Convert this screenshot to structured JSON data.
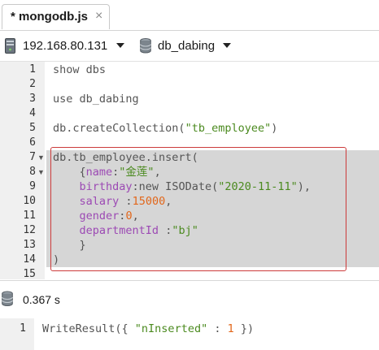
{
  "tab": {
    "title": "* mongodb.js",
    "close_icon": "close-icon"
  },
  "connection": {
    "host": "192.168.80.131",
    "database": "db_dabing"
  },
  "editor": {
    "line_numbers": [
      "1",
      "2",
      "3",
      "4",
      "5",
      "6",
      "7",
      "8",
      "9",
      "10",
      "11",
      "12",
      "13",
      "14",
      "15"
    ],
    "lines": [
      "show dbs",
      "",
      "use db_dabing",
      "",
      "db.createCollection(\"tb_employee\")",
      "",
      "db.tb_employee.insert(",
      "    {name:\"金莲\",",
      "    birthday:new ISODate(\"2020-11-11\"),",
      "    salary :15000,",
      "    gender:0,",
      "    departmentId :\"bj\"",
      "    }",
      ")",
      ""
    ],
    "selected_lines": [
      "7",
      "14"
    ],
    "colors": {
      "key": "#9c4ab4",
      "string": "#4b8a1f",
      "number": "#e2671b",
      "highlight_box": "#cc3b3b"
    }
  },
  "result_header": {
    "elapsed": "0.367 s"
  },
  "result": {
    "line_number": "1",
    "text": "WriteResult({ \"nInserted\" : 1 })"
  }
}
